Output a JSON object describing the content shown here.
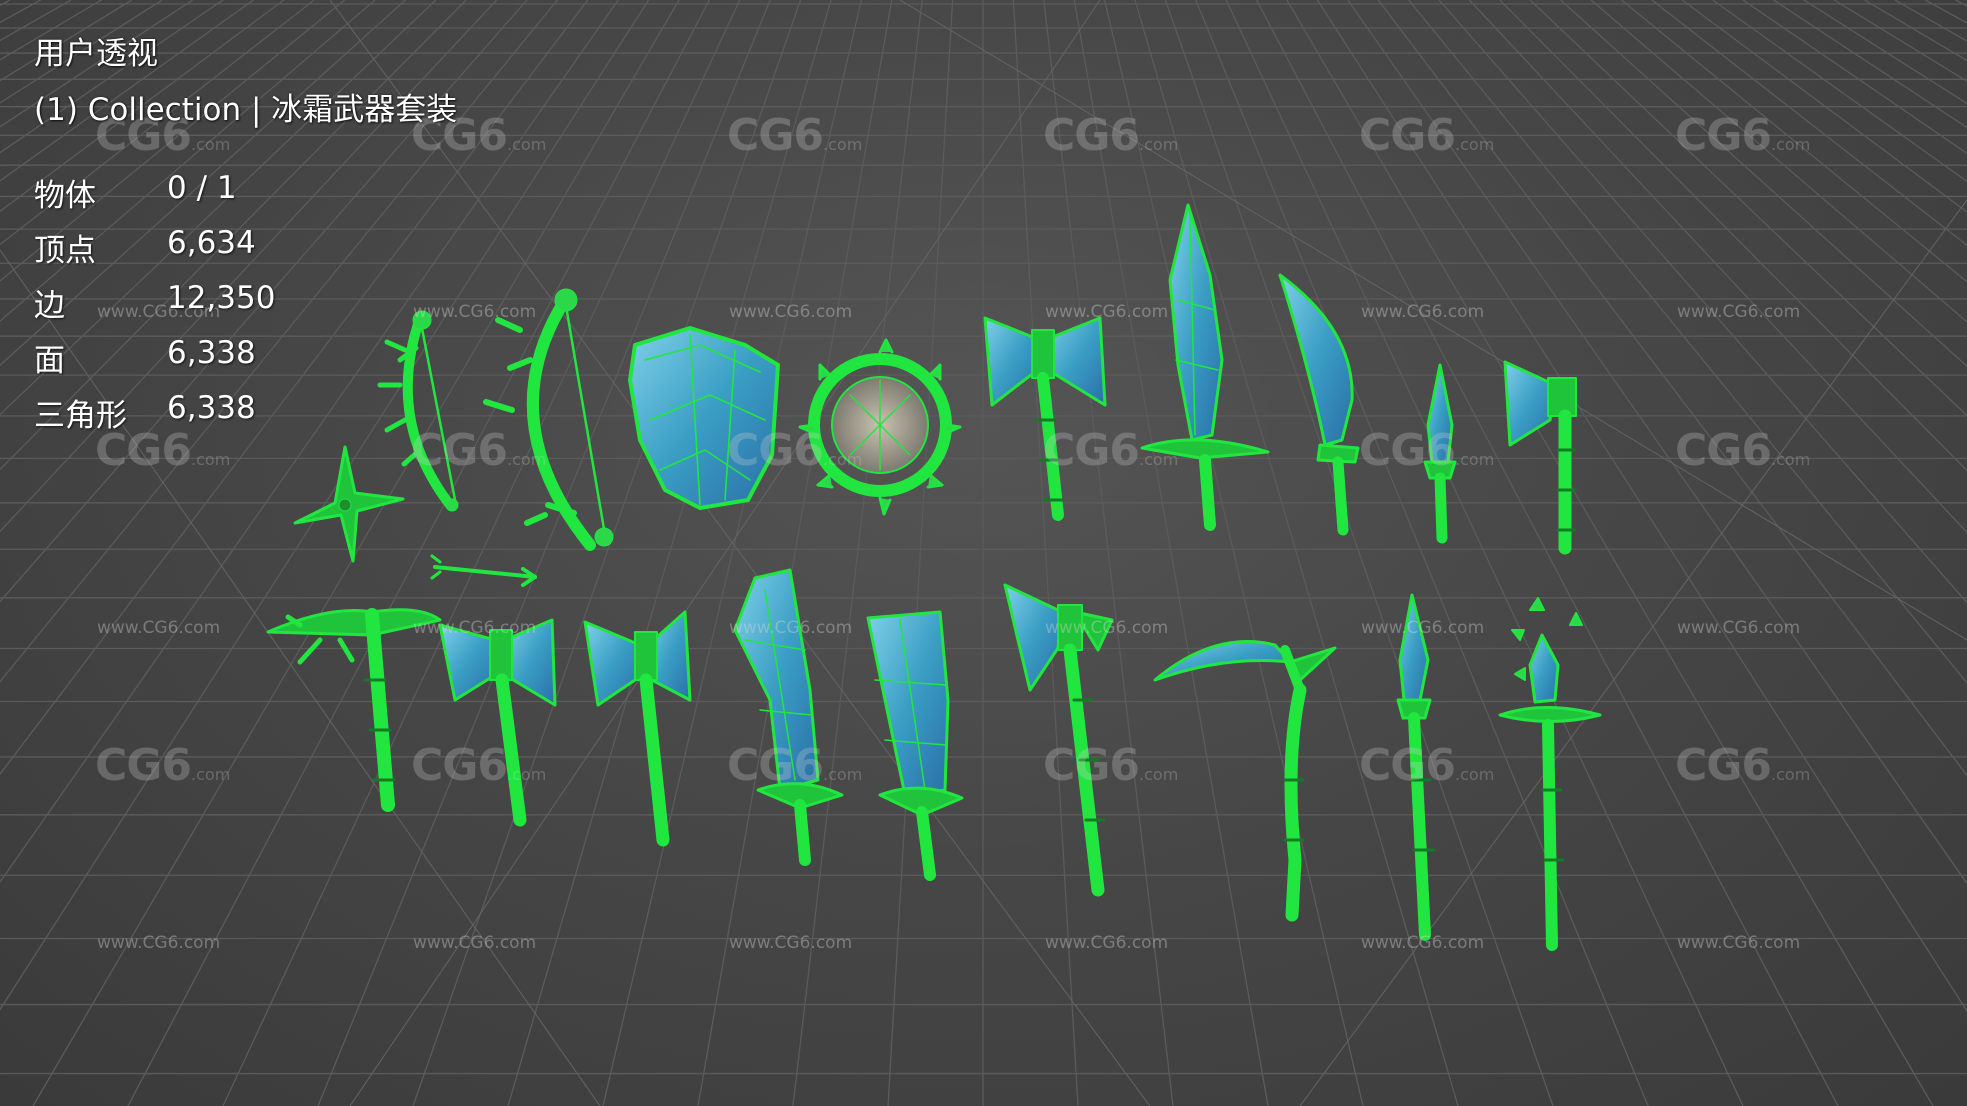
{
  "viewport": {
    "view_name": "用户透视",
    "collection_label": "(1) Collection | 冰霜武器套装"
  },
  "stats": [
    {
      "label": "物体",
      "value": "0 / 1"
    },
    {
      "label": "顶点",
      "value": "6,634"
    },
    {
      "label": "边",
      "value": "12,350"
    },
    {
      "label": "面",
      "value": "6,338"
    },
    {
      "label": "三角形",
      "value": "6,338"
    }
  ],
  "watermark": {
    "logo_text": "CG6",
    "logo_suffix": ".com",
    "url_text": "www.CG6.com"
  },
  "colors": {
    "background": "#474747",
    "grid_line": "#5a5a5a",
    "wire_green": "#22e640",
    "ice_blue": "#3aa6c8",
    "text": "#ffffff"
  },
  "objects": [
    "shuriken-icon",
    "bow-icon",
    "bow-icon",
    "arrow-icon",
    "shield-icon",
    "round-shield-icon",
    "double-axe-icon",
    "sword-icon",
    "curved-blade-icon",
    "dagger-icon",
    "axe-icon",
    "pickaxe-icon",
    "double-axe-icon",
    "double-axe-icon",
    "broad-sword-icon",
    "broad-sword-icon",
    "axe-icon",
    "scythe-icon",
    "spear-icon",
    "staff-icon"
  ]
}
